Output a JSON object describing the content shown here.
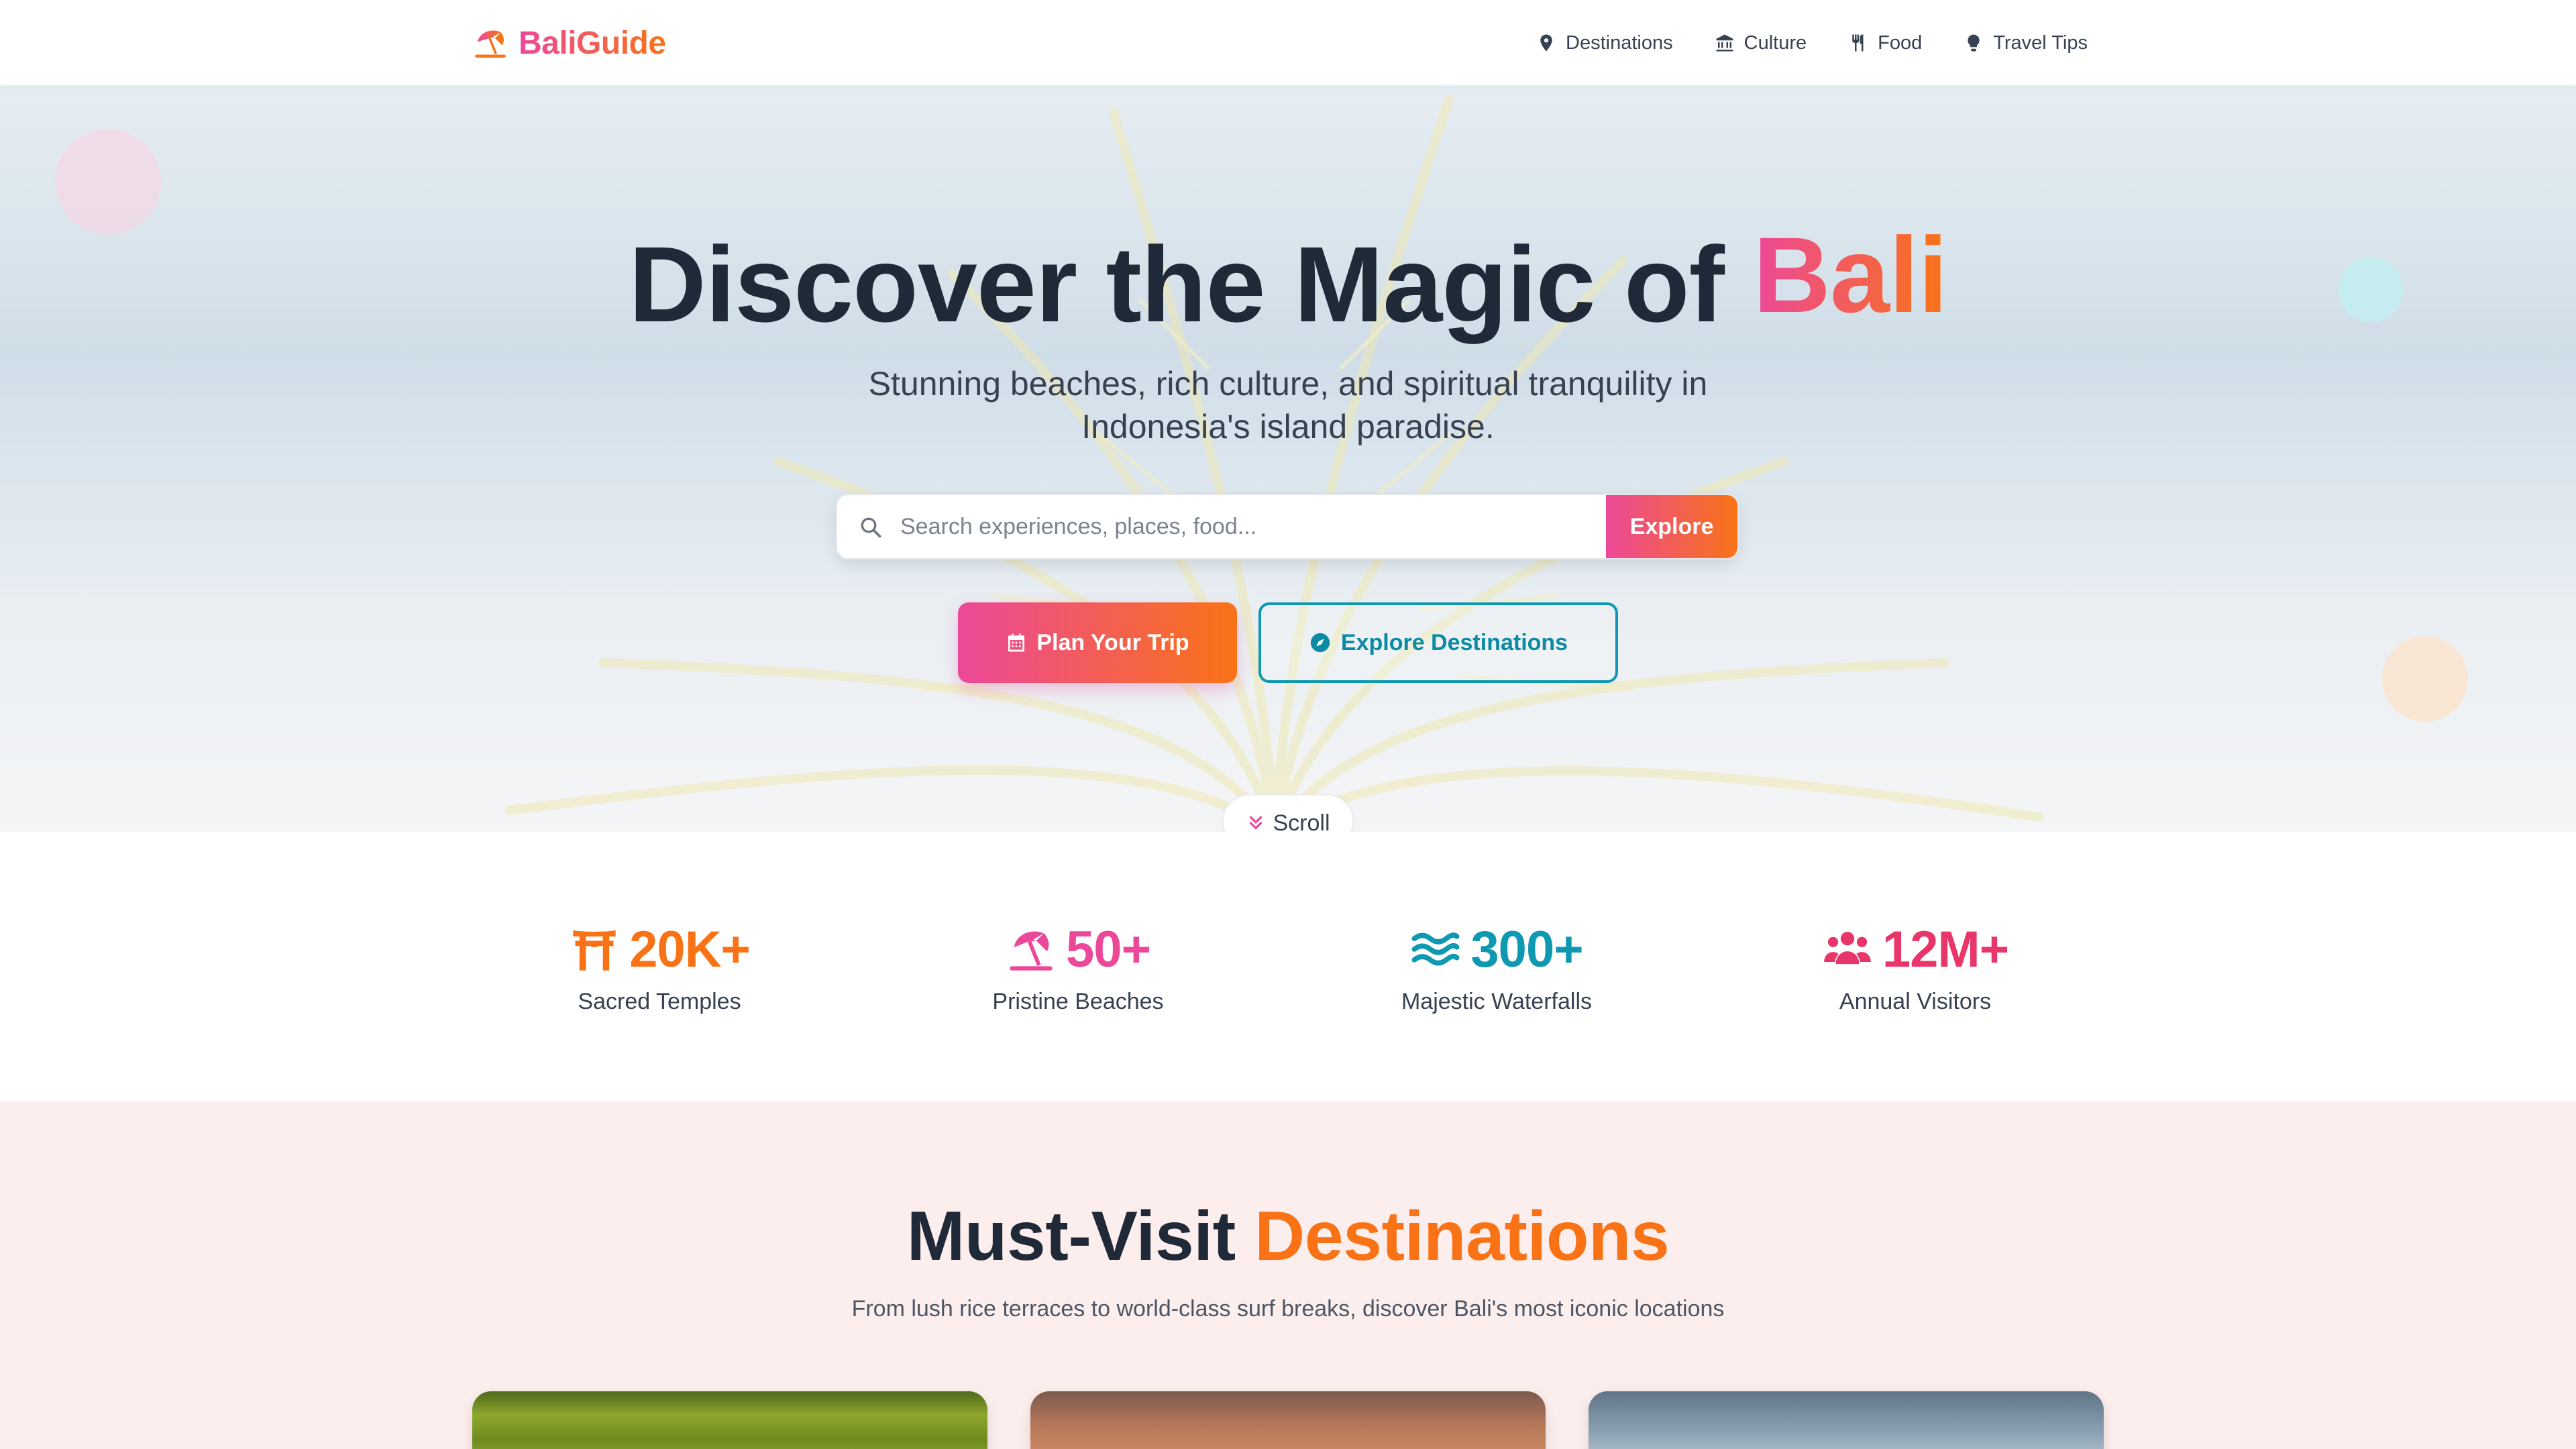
{
  "brand": {
    "name": "BaliGuide",
    "icon": "beach-umbrella-icon"
  },
  "nav": {
    "items": [
      {
        "label": "Destinations",
        "icon": "map-pin-icon"
      },
      {
        "label": "Culture",
        "icon": "landmark-icon"
      },
      {
        "label": "Food",
        "icon": "utensils-icon"
      },
      {
        "label": "Travel Tips",
        "icon": "lightbulb-icon"
      }
    ]
  },
  "hero": {
    "title_prefix": "Discover the Magic of",
    "title_accent": "Bali",
    "subtitle": "Stunning beaches, rich culture, and spiritual tranquility in Indonesia's island paradise.",
    "search": {
      "placeholder": "Search experiences, places, food...",
      "value": "",
      "button_label": "Explore"
    },
    "primary_button": {
      "label": "Plan Your Trip",
      "icon": "calendar-icon"
    },
    "secondary_button": {
      "label": "Explore Destinations",
      "icon": "compass-icon"
    },
    "scroll_label": "Scroll"
  },
  "stats": [
    {
      "value": "20K+",
      "label": "Sacred Temples",
      "icon": "torii-gate-icon",
      "color": "#f97316"
    },
    {
      "value": "50+",
      "label": "Pristine Beaches",
      "icon": "umbrella-beach-icon",
      "color": "#ec4899"
    },
    {
      "value": "300+",
      "label": "Majestic Waterfalls",
      "icon": "water-waves-icon",
      "color": "#0e98b2"
    },
    {
      "value": "12M+",
      "label": "Annual Visitors",
      "icon": "users-icon",
      "color": "#e8366a"
    }
  ],
  "destinations": {
    "title_prefix": "Must-Visit",
    "title_accent": "Destinations",
    "subtitle": "From lush rice terraces to world-class surf breaks, discover Bali's most iconic locations"
  },
  "theme": {
    "accent_pink": "#ec4899",
    "accent_orange": "#f97316",
    "accent_teal": "#0e98b2",
    "text_dark": "#1f2937",
    "section_bg_pink": "#fdeeee"
  }
}
